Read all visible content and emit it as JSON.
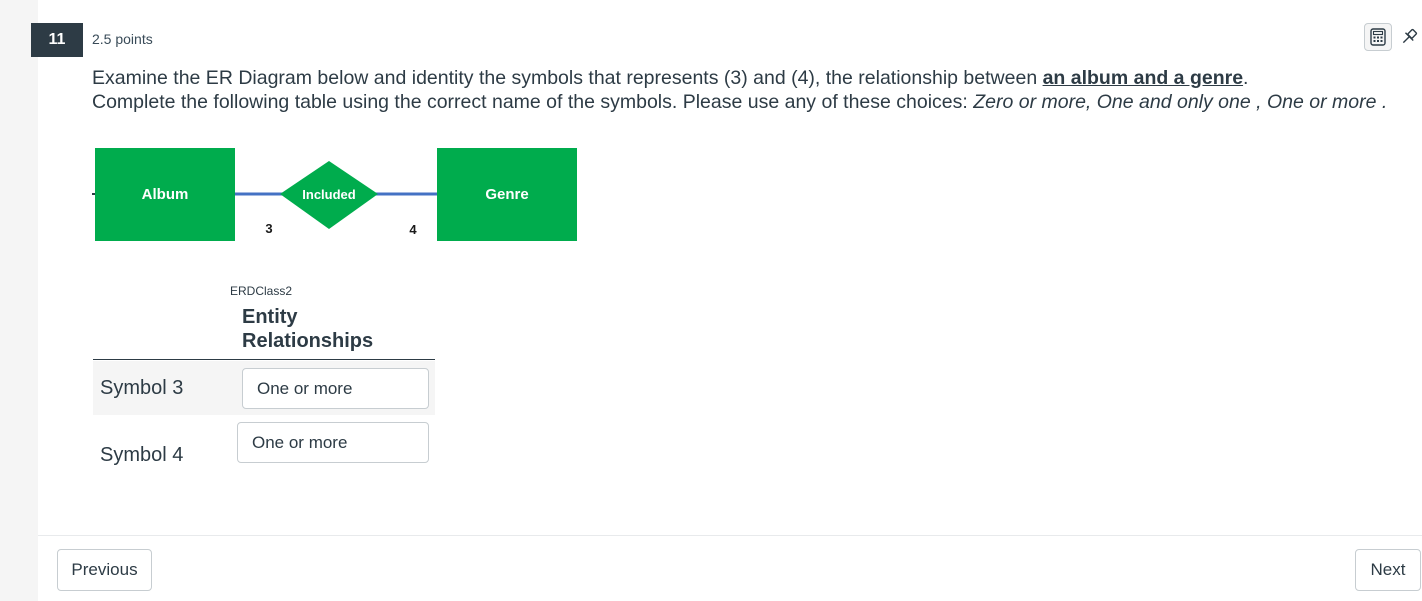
{
  "question": {
    "number": "11",
    "points": "2.5 points",
    "text_line1_prefix": "Examine the ER Diagram below and identity the symbols that represents (3) and (4), the relationship between ",
    "text_line1_emph": "an album and a genre",
    "text_line1_suffix": ".",
    "text_line2_prefix": "Complete the following table using the correct name of the symbols. Please use any of these choices: ",
    "text_line2_choices": "Zero or more, One and only one , One or more ."
  },
  "diagram": {
    "entity_left": "Album",
    "relationship": "Included",
    "entity_right": "Genre",
    "label_left": "3",
    "label_right": "4",
    "entity_color": "#00ac4d",
    "line_color": "#4472c4"
  },
  "table": {
    "caption": "ERDClass2",
    "header_line1": "Entity",
    "header_line2": "Relationships",
    "rows": [
      {
        "label": "Symbol 3",
        "value": "One or more"
      },
      {
        "label": "Symbol 4",
        "value": "One or more"
      }
    ]
  },
  "toolbar": {
    "calculator_icon": "calculator-icon",
    "pin_icon": "pin-icon"
  },
  "nav": {
    "previous_label": "Previous",
    "next_label": "Next"
  }
}
